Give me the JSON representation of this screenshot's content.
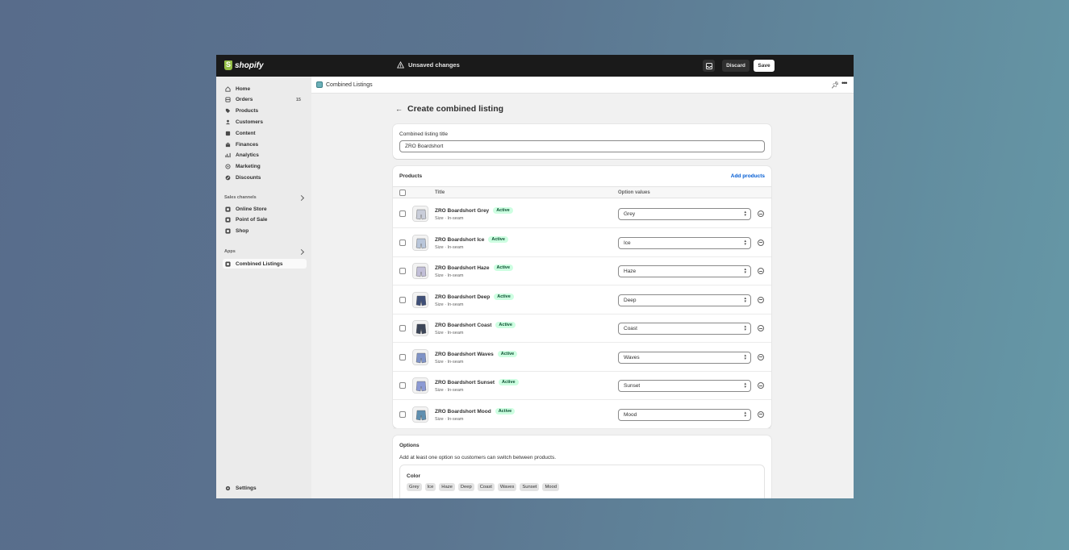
{
  "topbar": {
    "brand": "shopify",
    "status": "Unsaved changes",
    "discard_label": "Discard",
    "save_label": "Save"
  },
  "sidebar": {
    "items": [
      {
        "label": "Home",
        "icon": "home-icon"
      },
      {
        "label": "Orders",
        "icon": "orders-icon",
        "badge": "15"
      },
      {
        "label": "Products",
        "icon": "tag-icon"
      },
      {
        "label": "Customers",
        "icon": "person-icon"
      },
      {
        "label": "Content",
        "icon": "content-icon"
      },
      {
        "label": "Finances",
        "icon": "bank-icon"
      },
      {
        "label": "Analytics",
        "icon": "chart-icon"
      },
      {
        "label": "Marketing",
        "icon": "target-icon"
      },
      {
        "label": "Discounts",
        "icon": "discount-icon"
      }
    ],
    "sales_channels_label": "Sales channels",
    "channels": [
      {
        "label": "Online Store"
      },
      {
        "label": "Point of Sale"
      },
      {
        "label": "Shop"
      }
    ],
    "apps_label": "Apps",
    "apps": [
      {
        "label": "Combined Listings"
      }
    ],
    "settings_label": "Settings"
  },
  "appbar": {
    "title": "Combined Listings"
  },
  "page": {
    "title": "Create combined listing"
  },
  "title_card": {
    "label": "Combined listing title",
    "value": "ZRO Boardshort"
  },
  "products_card": {
    "title": "Products",
    "add_label": "Add products",
    "col_title": "Title",
    "col_option": "Option values",
    "rows": [
      {
        "name": "ZRO Boardshort Grey",
        "status": "Active",
        "sub": "Size · In-seam",
        "option": "Grey"
      },
      {
        "name": "ZRO Boardshort Ice",
        "status": "Active",
        "sub": "Size · In-seam",
        "option": "Ice"
      },
      {
        "name": "ZRO Boardshort Haze",
        "status": "Active",
        "sub": "Size · In-seam",
        "option": "Haze"
      },
      {
        "name": "ZRO Boardshort Deep",
        "status": "Active",
        "sub": "Size · In-seam",
        "option": "Deep"
      },
      {
        "name": "ZRO Boardshort Coast",
        "status": "Active",
        "sub": "Size · In-seam",
        "option": "Coast"
      },
      {
        "name": "ZRO Boardshort Waves",
        "status": "Active",
        "sub": "Size · In-seam",
        "option": "Waves"
      },
      {
        "name": "ZRO Boardshort Sunset",
        "status": "Active",
        "sub": "Size · In-seam",
        "option": "Sunset"
      },
      {
        "name": "ZRO Boardshort Mood",
        "status": "Active",
        "sub": "Size · In-seam",
        "option": "Mood"
      }
    ]
  },
  "options_card": {
    "title": "Options",
    "hint": "Add at least one option so customers can switch between products.",
    "option_name": "Color",
    "values": [
      "Grey",
      "Ice",
      "Haze",
      "Deep",
      "Coast",
      "Waves",
      "Sunset",
      "Mood"
    ]
  },
  "colors": {
    "topbar": "#1a1a1a",
    "link": "#005bd3",
    "active_badge_bg": "#cdfee1",
    "thumb_tints": [
      "#c9cdd9",
      "#b9c6da",
      "#c2bfd8",
      "#3f4f78",
      "#3c4558",
      "#7f93c7",
      "#8c9ad4",
      "#5f8fb0"
    ]
  }
}
